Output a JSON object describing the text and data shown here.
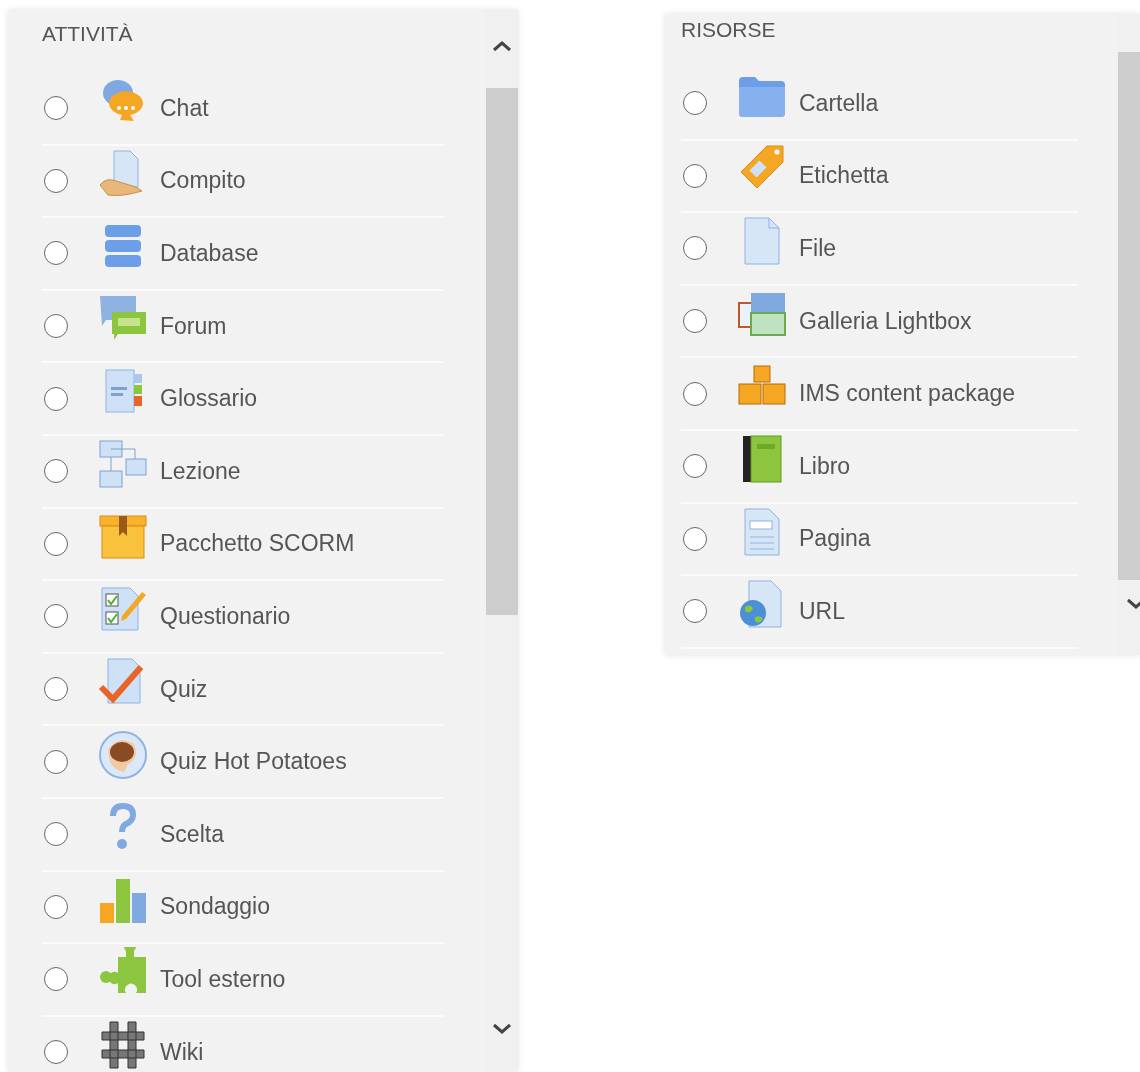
{
  "activities": {
    "title": "ATTIVITÀ",
    "items": [
      {
        "label": "Chat",
        "kind": "chat",
        "selected": false
      },
      {
        "label": "Compito",
        "kind": "assignment",
        "selected": false
      },
      {
        "label": "Database",
        "kind": "database",
        "selected": false
      },
      {
        "label": "Forum",
        "kind": "forum",
        "selected": false
      },
      {
        "label": "Glossario",
        "kind": "glossary",
        "selected": false
      },
      {
        "label": "Lezione",
        "kind": "lesson",
        "selected": false
      },
      {
        "label": "Pacchetto SCORM",
        "kind": "scorm",
        "selected": false
      },
      {
        "label": "Questionario",
        "kind": "questionnaire",
        "selected": false
      },
      {
        "label": "Quiz",
        "kind": "quiz",
        "selected": false
      },
      {
        "label": "Quiz Hot Potatoes",
        "kind": "hotpot",
        "selected": false
      },
      {
        "label": "Scelta",
        "kind": "choice",
        "selected": false
      },
      {
        "label": "Sondaggio",
        "kind": "survey",
        "selected": false
      },
      {
        "label": "Tool esterno",
        "kind": "lti",
        "selected": false
      },
      {
        "label": "Wiki",
        "kind": "wiki",
        "selected": false
      }
    ]
  },
  "resources": {
    "title": "RISORSE",
    "items": [
      {
        "label": "Cartella",
        "kind": "folder",
        "selected": false
      },
      {
        "label": "Etichetta",
        "kind": "label",
        "selected": false
      },
      {
        "label": "File",
        "kind": "file",
        "selected": false
      },
      {
        "label": "Galleria Lightbox",
        "kind": "gallery",
        "selected": false
      },
      {
        "label": "IMS content package",
        "kind": "imscp",
        "selected": false
      },
      {
        "label": "Libro",
        "kind": "book",
        "selected": false
      },
      {
        "label": "Pagina",
        "kind": "page",
        "selected": false
      },
      {
        "label": "URL",
        "kind": "url",
        "selected": false
      }
    ]
  }
}
